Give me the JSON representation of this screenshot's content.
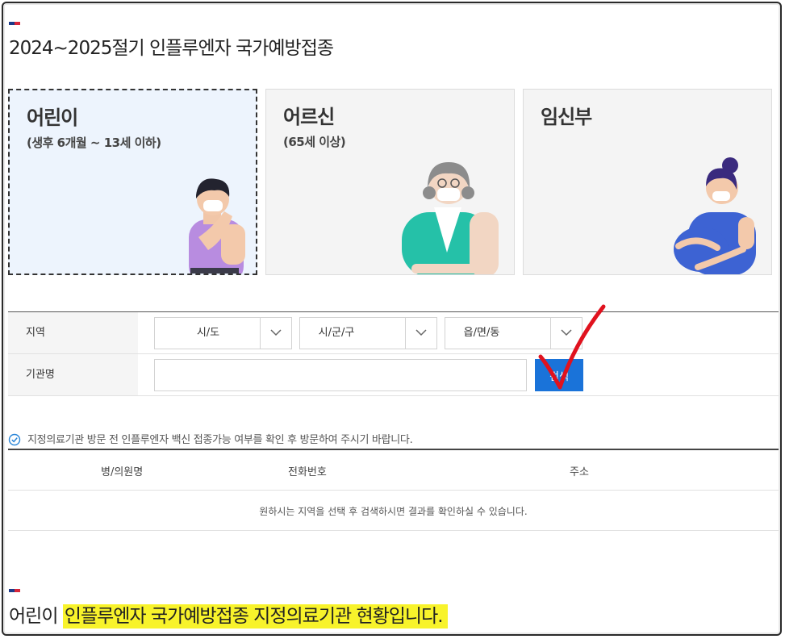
{
  "page_title": "2024~2025절기 인플루엔자 국가예방접종",
  "cards": [
    {
      "title": "어린이",
      "subtitle": "(생후 6개월 ~ 13세 이하)",
      "active": true
    },
    {
      "title": "어르신",
      "subtitle": "(65세 이상)",
      "active": false
    },
    {
      "title": "임신부",
      "subtitle": "",
      "active": false
    }
  ],
  "form": {
    "region_label": "지역",
    "sido_value": "시/도",
    "sigungu_value": "시/군/구",
    "eupmyeondong_value": "읍/면/동",
    "institution_label": "기관명",
    "institution_value": "",
    "search_label": "검색"
  },
  "notice": "지정의료기관 방문 전 인플루엔자 백신 접종가능 여부를 확인 후 방문하여 주시기 바랍니다.",
  "table": {
    "headers": [
      "병/의원명",
      "전화번호",
      "주소"
    ],
    "empty_message": "원하시는 지역을 선택 후 검색하시면 결과를 확인하실 수 있습니다."
  },
  "bottom_title": {
    "prefix": "어린이",
    "highlight": "인플루엔자 국가예방접종 지정의료기관 현황입니다."
  },
  "colors": {
    "accent_blue": "#1a73d9",
    "highlight_yellow": "#f8f32b",
    "check_red": "#e0121e"
  }
}
